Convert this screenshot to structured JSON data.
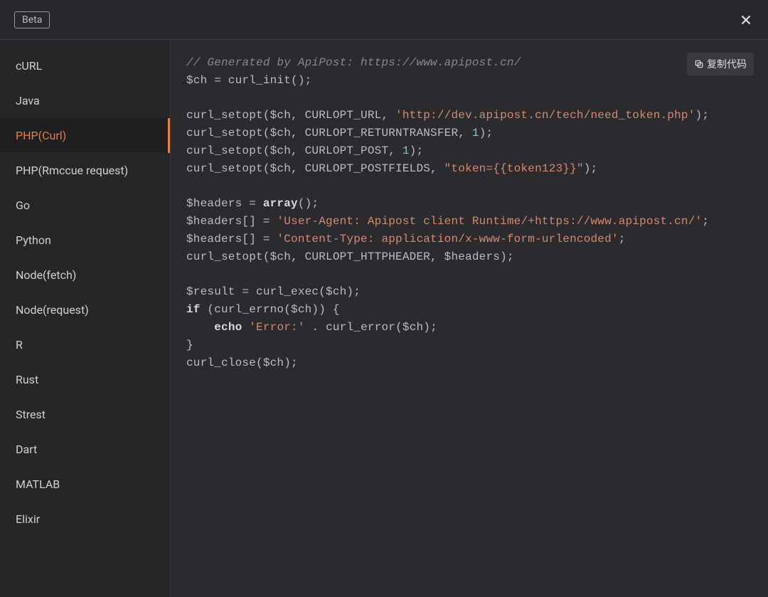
{
  "header": {
    "badge": "Beta"
  },
  "sidebar": {
    "items": [
      {
        "label": "cURL",
        "active": false
      },
      {
        "label": "Java",
        "active": false
      },
      {
        "label": "PHP(Curl)",
        "active": true
      },
      {
        "label": "PHP(Rmccue request)",
        "active": false
      },
      {
        "label": "Go",
        "active": false
      },
      {
        "label": "Python",
        "active": false
      },
      {
        "label": "Node(fetch)",
        "active": false
      },
      {
        "label": "Node(request)",
        "active": false
      },
      {
        "label": "R",
        "active": false
      },
      {
        "label": "Rust",
        "active": false
      },
      {
        "label": "Strest",
        "active": false
      },
      {
        "label": "Dart",
        "active": false
      },
      {
        "label": "MATLAB",
        "active": false
      },
      {
        "label": "Elixir",
        "active": false
      }
    ]
  },
  "content": {
    "copyLabel": "复制代码",
    "code": {
      "comment": "// Generated by ApiPost: https://www.apipost.cn/",
      "line_init": "$ch = curl_init();",
      "line_url_pre": "curl_setopt($ch, CURLOPT_URL, ",
      "line_url_str": "'http://dev.apipost.cn/tech/need_token.php'",
      "line_url_post": ");",
      "line_rt_pre": "curl_setopt($ch, CURLOPT_RETURNTRANSFER, ",
      "line_rt_num": "1",
      "line_rt_post": ");",
      "line_post_pre": "curl_setopt($ch, CURLOPT_POST, ",
      "line_post_num": "1",
      "line_post_post": ");",
      "line_pf_pre": "curl_setopt($ch, CURLOPT_POSTFIELDS, ",
      "line_pf_str": "\"token={{token123}}\"",
      "line_pf_post": ");",
      "line_h1_pre": "$headers = ",
      "line_h1_kw": "array",
      "line_h1_post": "();",
      "line_h2_pre": "$headers[] = ",
      "line_h2_str": "'User-Agent: Apipost client Runtime/+https://www.apipost.cn/'",
      "line_h2_post": ";",
      "line_h3_pre": "$headers[] = ",
      "line_h3_str": "'Content-Type: application/x-www-form-urlencoded'",
      "line_h3_post": ";",
      "line_sethdr": "curl_setopt($ch, CURLOPT_HTTPHEADER, $headers);",
      "line_exec": "$result = curl_exec($ch);",
      "line_if_kw": "if",
      "line_if_rest": " (curl_errno($ch)) {",
      "line_echo_indent": "    ",
      "line_echo_kw": "echo",
      "line_echo_sp": " ",
      "line_echo_str": "'Error:'",
      "line_echo_rest": " . curl_error($ch);",
      "line_closebrace": "}",
      "line_close": "curl_close($ch);"
    }
  }
}
